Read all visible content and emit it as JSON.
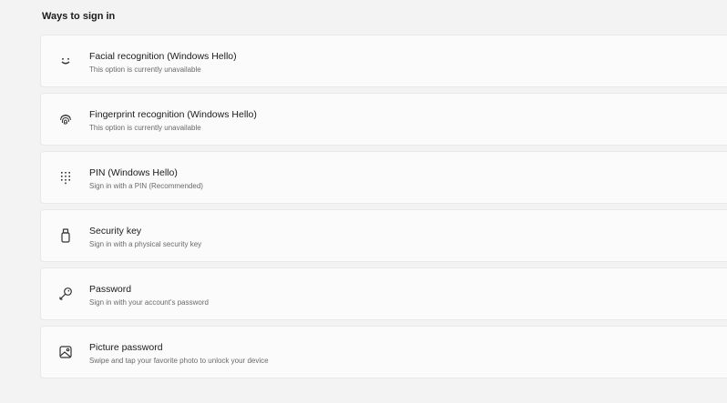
{
  "section": {
    "title": "Ways to sign in"
  },
  "options": [
    {
      "title": "Facial recognition (Windows Hello)",
      "description": "This option is currently unavailable",
      "icon": "face-icon"
    },
    {
      "title": "Fingerprint recognition (Windows Hello)",
      "description": "This option is currently unavailable",
      "icon": "fingerprint-icon"
    },
    {
      "title": "PIN (Windows Hello)",
      "description": "Sign in with a PIN (Recommended)",
      "icon": "pin-keypad-icon"
    },
    {
      "title": "Security key",
      "description": "Sign in with a physical security key",
      "icon": "usb-key-icon"
    },
    {
      "title": "Password",
      "description": "Sign in with your account's password",
      "icon": "key-icon"
    },
    {
      "title": "Picture password",
      "description": "Swipe and tap your favorite photo to unlock your device",
      "icon": "picture-icon"
    }
  ]
}
